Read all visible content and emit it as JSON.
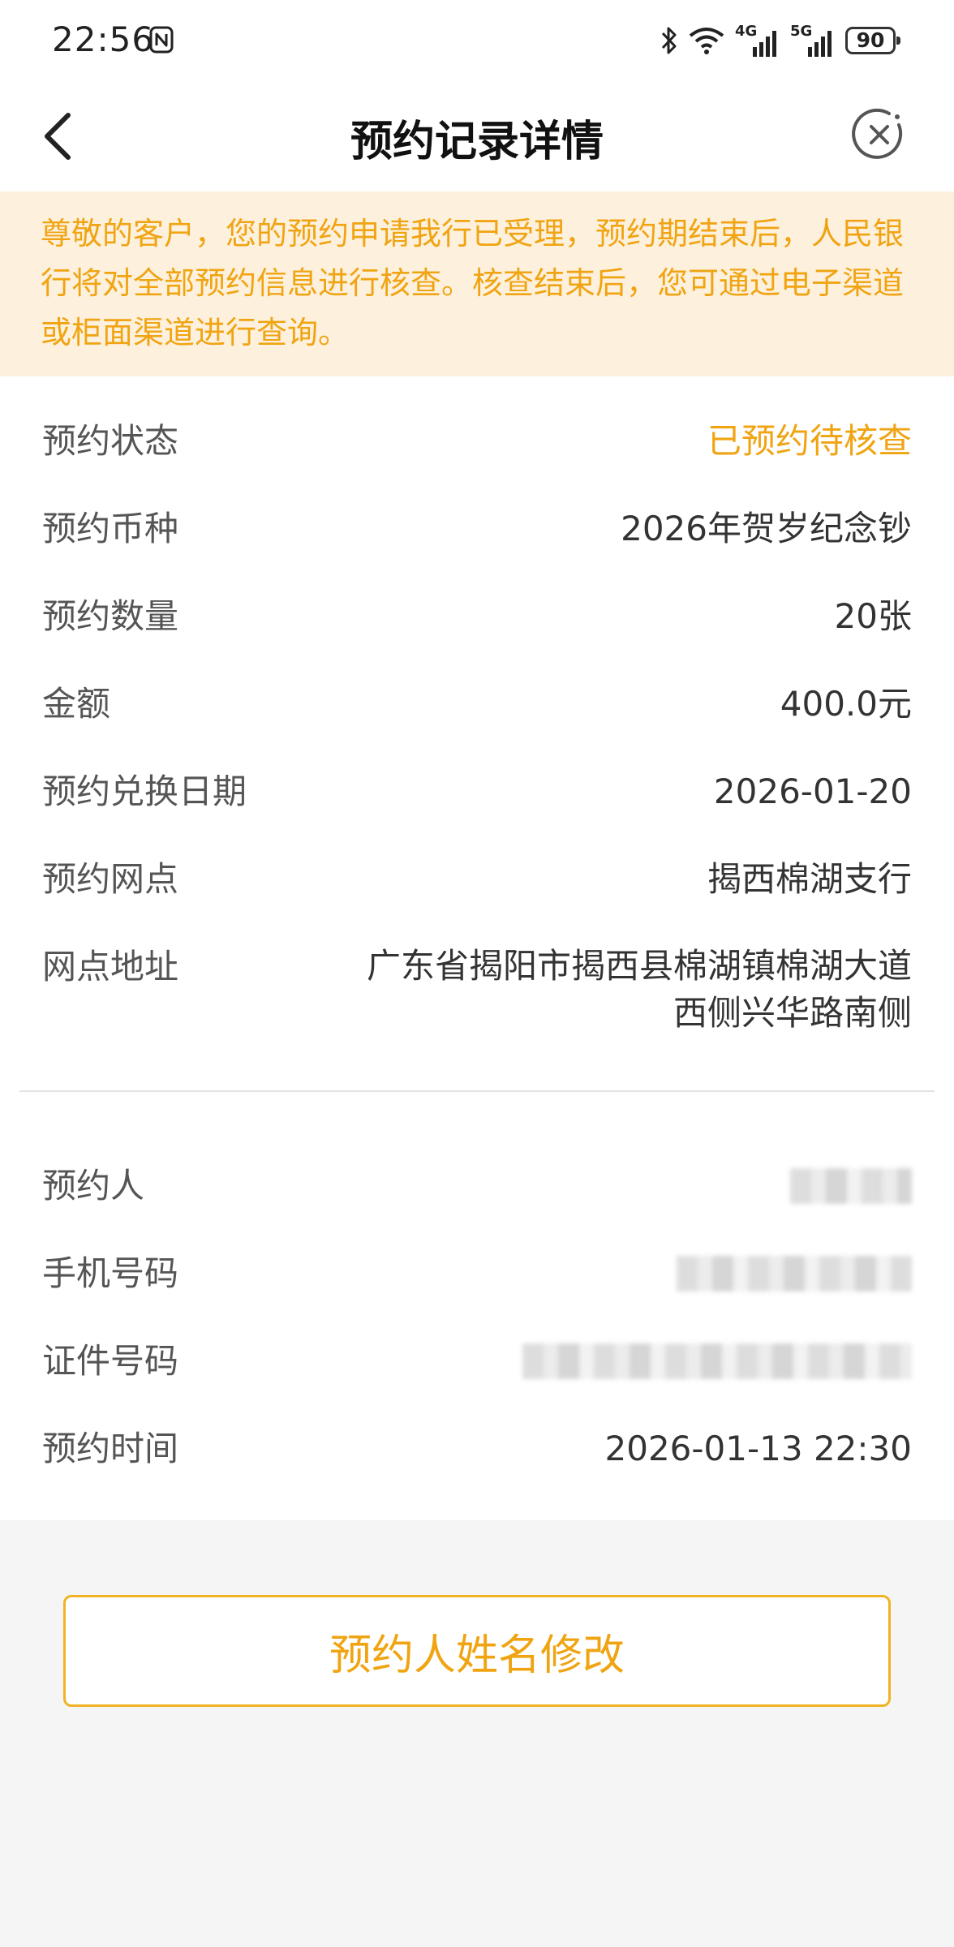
{
  "status_bar": {
    "time": "22:56",
    "network_1": "4G",
    "network_2": "5G",
    "battery": "90",
    "icons": [
      "nfc-icon",
      "bluetooth-icon",
      "wifi-icon",
      "signal-icon",
      "battery-icon"
    ]
  },
  "header": {
    "title": "预约记录详情",
    "back_icon": "chevron-left-icon",
    "close_icon": "close-circle-icon"
  },
  "notice": {
    "text": "尊敬的客户，您的预约申请我行已受理，预约期结束后，人民银行将对全部预约信息进行核查。核查结束后，您可通过电子渠道或柜面渠道进行查询。"
  },
  "details": [
    {
      "label": "预约状态",
      "value": "已预约待核查"
    },
    {
      "label": "预约币种",
      "value": "2026年贺岁纪念钞"
    },
    {
      "label": "预约数量",
      "value": "20张"
    },
    {
      "label": "金额",
      "value": "400.0元"
    },
    {
      "label": "预约兑换日期",
      "value": "2026-01-20"
    },
    {
      "label": "预约网点",
      "value": "揭西棉湖支行"
    },
    {
      "label": "网点地址",
      "value": "广东省揭阳市揭西县棉湖镇棉湖大道西侧兴华路南侧"
    }
  ],
  "personal": [
    {
      "label": "预约人"
    },
    {
      "label": "手机号码"
    },
    {
      "label": "证件号码"
    },
    {
      "label": "预约时间",
      "value": "2026-01-13 22:30"
    }
  ],
  "colors": {
    "accent": "#f0a412",
    "notice_bg": "#fdf1de",
    "button_border": "#f0b324",
    "page_bg": "#f5f5f5"
  },
  "action_button": {
    "label": "预约人姓名修改"
  }
}
